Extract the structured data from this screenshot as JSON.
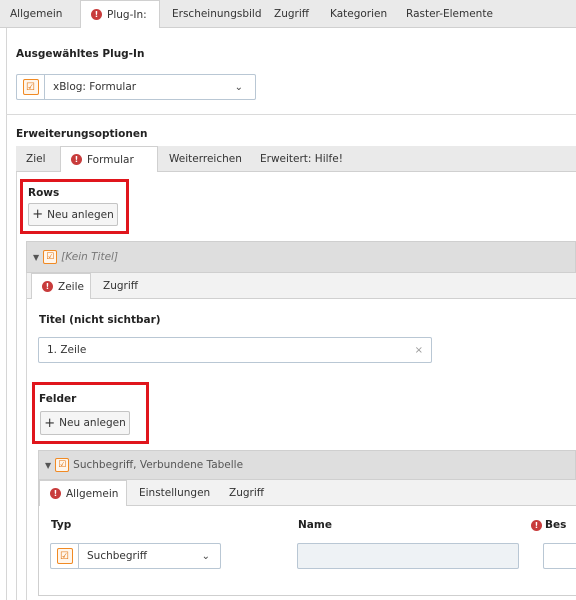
{
  "top_tabs": [
    {
      "label": "Allgemein",
      "error": false
    },
    {
      "label": "Plug-In:",
      "error": true
    },
    {
      "label": "Erscheinungsbild",
      "error": false
    },
    {
      "label": "Zugriff",
      "error": false
    },
    {
      "label": "Kategorien",
      "error": false
    },
    {
      "label": "Raster-Elemente",
      "error": false
    }
  ],
  "selected_plugin": {
    "heading": "Ausgewähltes Plug-In",
    "value": "xBlog: Formular"
  },
  "extension_options": {
    "heading": "Erweiterungsoptionen",
    "tabs": [
      {
        "label": "Ziel",
        "error": false
      },
      {
        "label": "Formular",
        "error": true
      },
      {
        "label": "Weiterreichen",
        "error": false
      },
      {
        "label": "Erweitert: Hilfe!",
        "error": false
      }
    ]
  },
  "rows": {
    "heading": "Rows",
    "new_button": "Neu anlegen"
  },
  "row_record": {
    "title": "[Kein Titel]",
    "tabs": [
      {
        "label": "Zeile",
        "error": true
      },
      {
        "label": "Zugriff",
        "error": false
      }
    ],
    "title_field_label": "Titel (nicht sichtbar)",
    "title_field_value": "1. Zeile",
    "clear_icon": "×"
  },
  "fields": {
    "heading": "Felder",
    "new_button": "Neu anlegen"
  },
  "field_record": {
    "title": "Suchbegriff, Verbundene Tabelle",
    "tabs": [
      {
        "label": "Allgemein",
        "error": true
      },
      {
        "label": "Einstellungen",
        "error": false
      },
      {
        "label": "Zugriff",
        "error": false
      }
    ],
    "type_label": "Typ",
    "type_value": "Suchbegriff",
    "name_label": "Name",
    "desc_label": "Bes"
  },
  "icons": {
    "error": "!",
    "plus": "+",
    "chevron": "⌄",
    "caret": "▼"
  },
  "colors": {
    "highlight": "#e0151c",
    "error": "#c83c3c",
    "extension_icon": "#f08a24"
  }
}
